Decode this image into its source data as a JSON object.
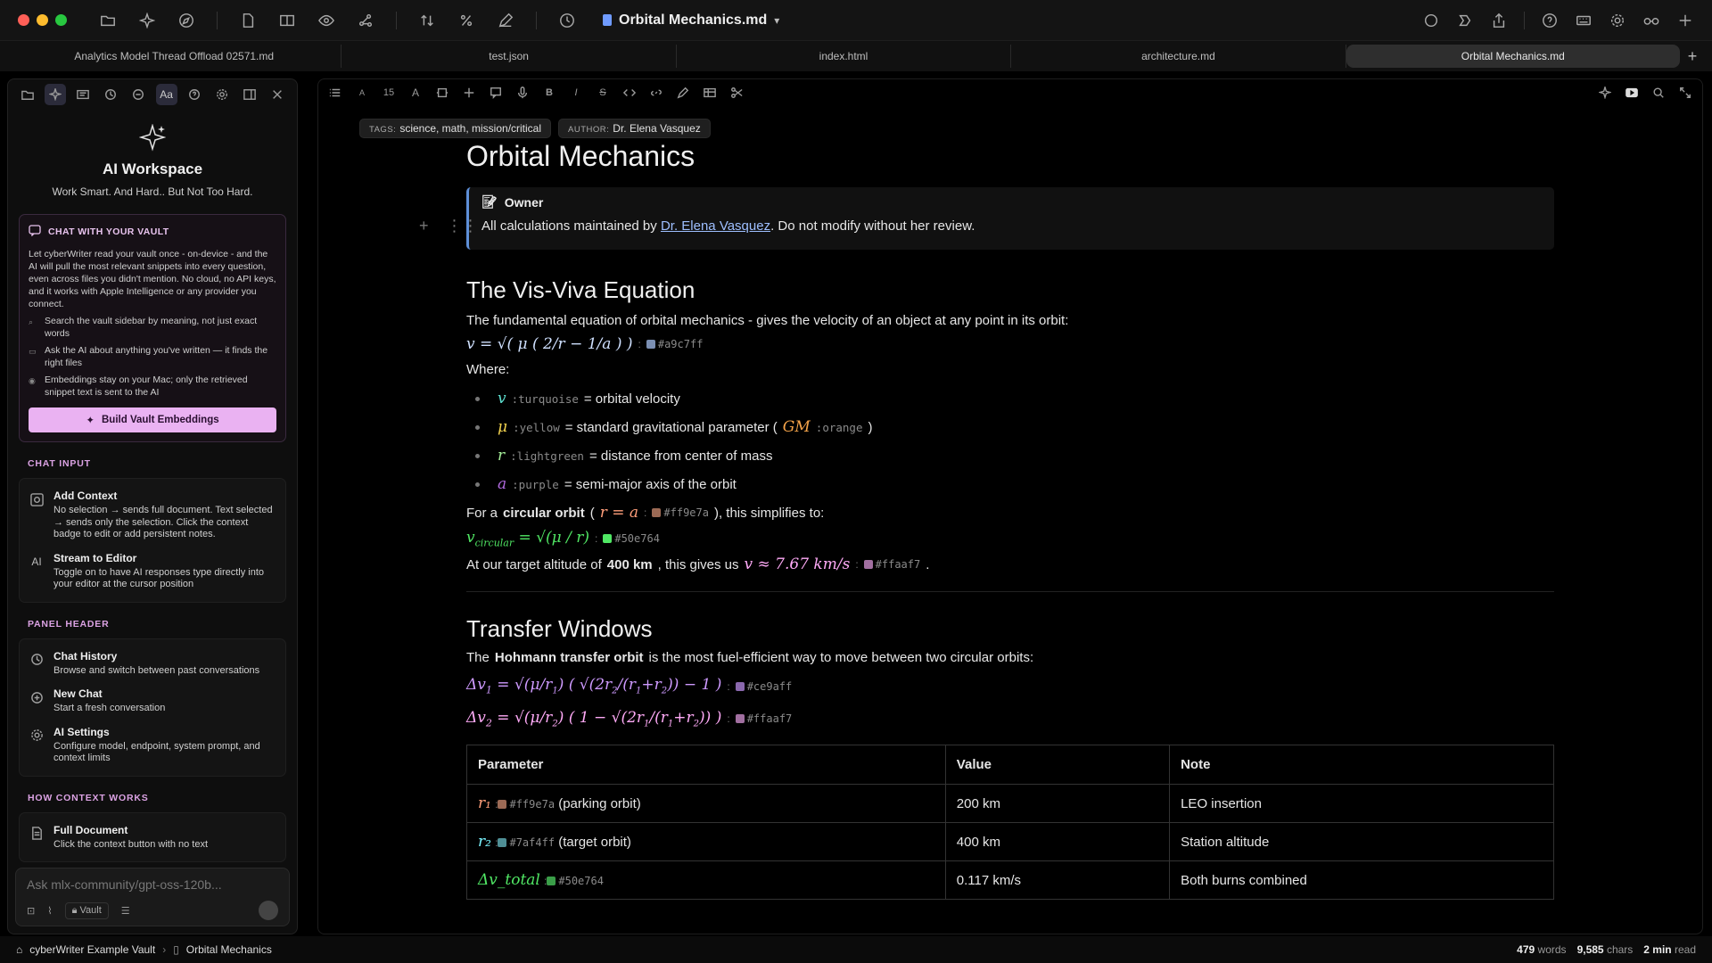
{
  "window": {
    "doc_title": "Orbital Mechanics.md",
    "traffic_colors": [
      "#ff5f57",
      "#febc2e",
      "#28c840"
    ]
  },
  "tabs": [
    {
      "label": "Analytics Model Thread Offload 02571.md",
      "active": false
    },
    {
      "label": "test.json",
      "active": false
    },
    {
      "label": "index.html",
      "active": false
    },
    {
      "label": "architecture.md",
      "active": false
    },
    {
      "label": "Orbital Mechanics.md",
      "active": true
    }
  ],
  "sidebar": {
    "title": "AI Workspace",
    "subtitle": "Work Smart. And Hard.. But Not Too Hard.",
    "vault_card": {
      "heading": "CHAT WITH YOUR VAULT",
      "body": "Let cyberWriter read your vault once - on-device - and the AI will pull the most relevant snippets into every question, even across files you didn't mention. No cloud, no API keys, and it works with Apple Intelligence or any provider you connect.",
      "items": [
        "Search the vault sidebar by meaning, not just exact words",
        "Ask the AI about anything you've written — it finds the right files",
        "Embeddings stay on your Mac; only the retrieved snippet text is sent to the AI"
      ],
      "button": "Build Vault Embeddings"
    },
    "sections": [
      {
        "label": "CHAT INPUT",
        "rows": [
          {
            "title": "Add Context",
            "desc": "No selection → sends full document. Text selected → sends only the selection. Click the context badge to edit or add persistent notes.",
            "icon": "context-icon"
          },
          {
            "title": "Stream to Editor",
            "desc": "Toggle on to have AI responses type directly into your editor at the cursor position",
            "icon": "ai-stream-icon"
          }
        ]
      },
      {
        "label": "PANEL HEADER",
        "rows": [
          {
            "title": "Chat History",
            "desc": "Browse and switch between past conversations",
            "icon": "history-icon"
          },
          {
            "title": "New Chat",
            "desc": "Start a fresh conversation",
            "icon": "new-chat-icon"
          },
          {
            "title": "AI Settings",
            "desc": "Configure model, endpoint, system prompt, and context limits",
            "icon": "gear-icon"
          }
        ]
      },
      {
        "label": "HOW CONTEXT WORKS",
        "rows": [
          {
            "title": "Full Document",
            "desc": "Click the context button with no text",
            "icon": "document-icon"
          }
        ]
      }
    ],
    "chat_placeholder": "Ask mlx-community/gpt-oss-120b...",
    "vault_chip": "Vault"
  },
  "editor": {
    "font_size": "15",
    "tags_key": "TAGS:",
    "tags_value": "science, math, mission/critical",
    "author_key": "AUTHOR:",
    "author_value": "Dr. Elena Vasquez",
    "h1": "Orbital Mechanics",
    "callout_title": "Owner",
    "callout_pre": "All calculations maintained by ",
    "callout_link": "Dr. Elena Vasquez",
    "callout_post": ". Do not modify without her review.",
    "h2_visviva": "The Vis-Viva Equation",
    "visviva_intro": "The fundamental equation of orbital mechanics - gives the velocity of an object at any point in its orbit:",
    "visviva_hex": "#a9c7ff",
    "where": "Where:",
    "vars": [
      {
        "sym": "v",
        "color_name": ":turquoise",
        "color": "#5de0d0",
        "desc": "= orbital velocity"
      },
      {
        "sym": "μ",
        "color_name": ":yellow",
        "color": "#f2d34f",
        "desc": "= standard gravitational parameter (",
        "extra_sym": "GM",
        "extra_name": ":orange",
        "extra_color": "#f5a44a",
        "tail": ")"
      },
      {
        "sym": "r",
        "color_name": ":lightgreen",
        "color": "#a6ef9a",
        "desc": "= distance from center of mass"
      },
      {
        "sym": "a",
        "color_name": ":purple",
        "color": "#b06adf",
        "desc": "= semi-major axis of the orbit"
      }
    ],
    "circular_pre": "For a ",
    "circular_bold": "circular orbit",
    "circular_open": " (",
    "circular_eq": "r = a",
    "circular_hex": "#ff9e7a",
    "circular_post": "), this simplifies to:",
    "vcirc_hex": "#50e764",
    "target_pre": "At our target altitude of ",
    "target_bold": "400 km",
    "target_mid": ", this gives us ",
    "target_eq": "v ≈ 7.67 km/s",
    "target_hex": "#ffaaf7",
    "h2_transfer": "Transfer Windows",
    "transfer_pre": "The ",
    "transfer_bold": "Hohmann transfer orbit",
    "transfer_post": " is the most fuel-efficient way to move between two circular orbits:",
    "dv1_hex": "#ce9aff",
    "dv2_hex": "#ffaaf7",
    "table": {
      "headers": [
        "Parameter",
        "Value",
        "Note"
      ],
      "rows": [
        {
          "sym": "r₁",
          "hex": "#ff9e7a",
          "label": "(parking orbit)",
          "value": "200 km",
          "note": "LEO insertion",
          "color": "#ff9e7a"
        },
        {
          "sym": "r₂",
          "hex": "#7af4ff",
          "label": "(target orbit)",
          "value": "400 km",
          "note": "Station altitude",
          "color": "#7af4ff"
        },
        {
          "sym": "Δv_total",
          "hex": "#50e764",
          "label": "",
          "value": "0.117 km/s",
          "note": "Both burns combined",
          "color": "#50e764"
        }
      ]
    }
  },
  "status": {
    "vault": "cyberWriter Example Vault",
    "doc": "Orbital Mechanics",
    "words_num": "479",
    "words_unit": "words",
    "chars_num": "9,585",
    "chars_unit": "chars",
    "read_num": "2 min",
    "read_unit": "read"
  }
}
